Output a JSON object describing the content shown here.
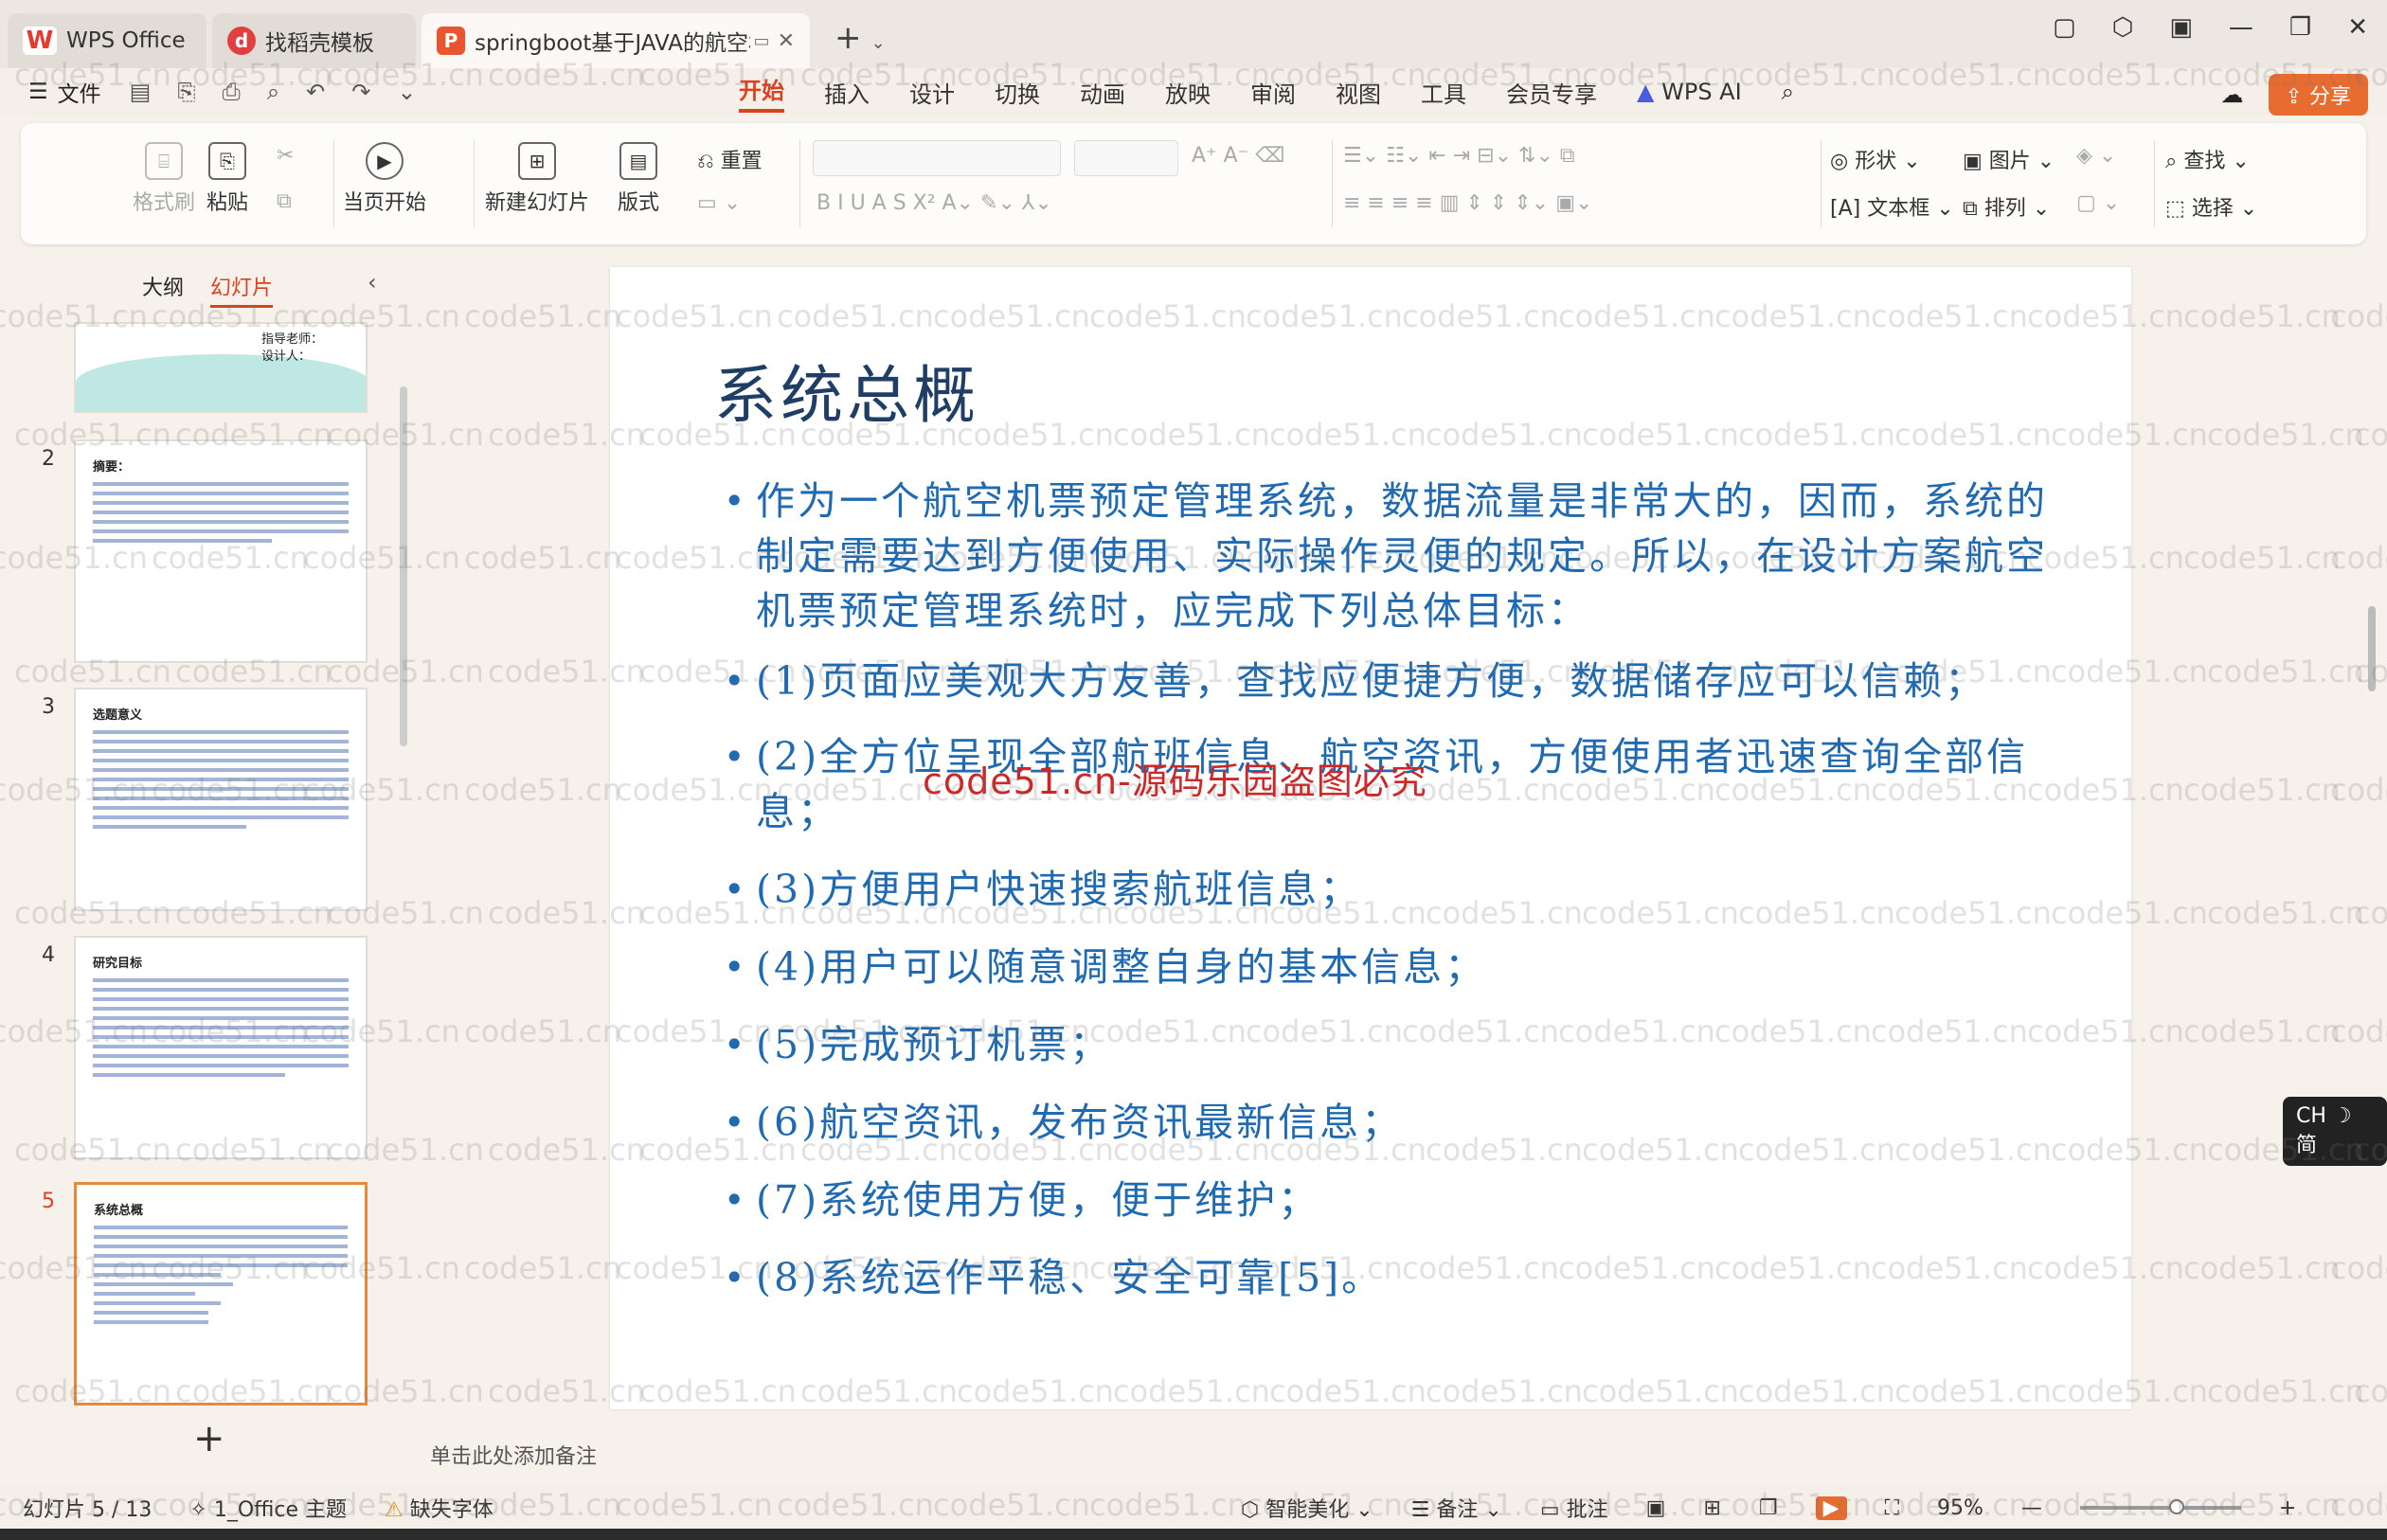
{
  "tabs": [
    {
      "label": "WPS Office",
      "icon": "wps-logo-icon"
    },
    {
      "label": "找稻壳模板",
      "icon": "docer-icon"
    },
    {
      "label": "springboot基于JAVA的航空机",
      "icon": "ppt-icon"
    }
  ],
  "menu": {
    "file_label": "文件",
    "tabs": [
      "开始",
      "插入",
      "设计",
      "切换",
      "动画",
      "放映",
      "审阅",
      "视图",
      "工具",
      "会员专享"
    ],
    "active_tab": "开始",
    "wps_ai": "WPS AI",
    "share_label": "分享"
  },
  "ribbon": {
    "format_painter": "格式刷",
    "paste": "粘贴",
    "play_from_current": "当页开始",
    "new_slide": "新建幻灯片",
    "layout": "版式",
    "reset": "重置",
    "shape": "形状",
    "picture": "图片",
    "find": "查找",
    "textbox": "文本框",
    "arrange": "排列",
    "select": "选择"
  },
  "panel": {
    "outline_tab": "大纲",
    "slides_tab": "幻灯片",
    "first_thumb_text": [
      "指导老师：",
      "设计人："
    ],
    "thumbnails": [
      {
        "num": "2",
        "title": "摘要："
      },
      {
        "num": "3",
        "title": "选题意义"
      },
      {
        "num": "4",
        "title": "研究目标"
      },
      {
        "num": "5",
        "title": "系统总概"
      }
    ]
  },
  "slide": {
    "title": "系统总概",
    "bullets": [
      "作为一个航空机票预定管理系统，数据流量是非常大的，因而，系统的制定需要达到方便使用、实际操作灵便的规定。所以，在设计方案航空机票预定管理系统时，应完成下列总体目标：",
      "(1)页面应美观大方友善，查找应便捷方便，数据储存应可以信赖；",
      "(2)全方位呈现全部航班信息、航空资讯，方便使用者迅速查询全部信息；",
      "(3)方便用户快速搜索航班信息；",
      "(4)用户可以随意调整自身的基本信息；",
      "(5)完成预订机票；",
      "(6)航空资讯，发布资讯最新信息；",
      "(7)系统使用方便，便于维护；",
      "(8)系统运作平稳、安全可靠[5]。"
    ],
    "overlay": "code51.cn-源码乐园盗图必究"
  },
  "notes_placeholder": "单击此处添加备注",
  "status": {
    "slide_count": "幻灯片 5 / 13",
    "theme": "1_Office 主题",
    "missing_font": "缺失字体",
    "smart_beautify": "智能美化",
    "notes": "备注",
    "comments": "批注",
    "zoom": "95%",
    "zoom_fraction": 0.6
  },
  "ime": "CH ☽ 简",
  "watermark": "code51.cn",
  "colors": {
    "accent": "#d9411f",
    "slide_text": "#1f6ab0",
    "title": "#1f3e66",
    "overlay": "#d02525"
  }
}
